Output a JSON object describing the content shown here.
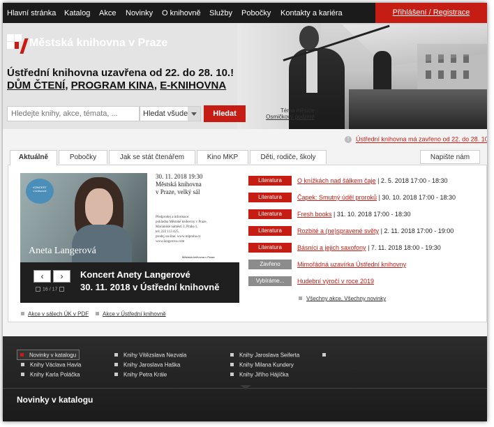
{
  "nav": {
    "items": [
      "Hlavní stránka",
      "Katalog",
      "Akce",
      "Novinky",
      "O knihovně",
      "Služby",
      "Pobočky",
      "Kontakty a kariéra"
    ],
    "login": "Přihlášení / Registrace"
  },
  "hero": {
    "logo_text": "Městská knihovna v Praze",
    "headline": "Ústřední knihovna uzavřena od 22. do 28. 10.!",
    "links": [
      "DŮM ČTENÍ",
      "PROGRAM KINA",
      "E-KNIHOVNA"
    ],
    "link_separator": ", ",
    "search_placeholder": "Hledejte knihy, akce, témata, ...",
    "search_scope": "Hledat všude",
    "search_button": "Hledat",
    "tema_label": "Téma měsíce",
    "tema_link": "Osmičkový podzim!"
  },
  "notice": {
    "icon": "!",
    "text": "Ústřední knihovna má zavřeno od 22. do 28. 10. 2018"
  },
  "tabs": [
    "Aktuálně",
    "Pobočky",
    "Jak se stát čtenářem",
    "Kino MKP",
    "Děti, rodiče, školy"
  ],
  "write_us": "Napište nám",
  "feature": {
    "poster_name": "Aneta Langerová",
    "poster_title": "30. 11. 2018 19:30\nMěstská knihovna\nv Praze, velký sál",
    "poster_small": "Předprodej a informace:\npokladna Městské knihovny v Praze,\nMariánské náměstí 1, Praha 1,\ntel: 222 113 425,\nprodej on-line: www.mlpraha.cz\nwww.langerova.com",
    "poster_badge": "KONCERT\nv knihovně",
    "poster_logo": "Městská knihovna v Praze",
    "caption_line1": "Koncert Anety Langerové",
    "caption_line2": "30. 11. 2018 v Ústřední knihovně",
    "prev": "‹",
    "next": "›",
    "counter": "16 / 17"
  },
  "feature_links": [
    "Akce v sálech ÚK v PDF",
    "Akce v Ústřední knihovně"
  ],
  "events": [
    {
      "tag": "Literatura",
      "title": "O knížkách nad šálkem čaje",
      "date": " | 2. 5. 2018 17:00 - 18:30",
      "gray": false
    },
    {
      "tag": "Literatura",
      "title": "Čapek: Smutný úděl proroků",
      "date": " | 30. 10. 2018 17:00 - 18:30",
      "gray": false
    },
    {
      "tag": "Literatura",
      "title": "Fresh books",
      "date": " | 31. 10. 2018 17:00 - 18:30",
      "gray": false
    },
    {
      "tag": "Literatura",
      "title": "Rozbité a (ne)spravené světy",
      "date": " | 2. 11. 2018 17:00 - 19:00",
      "gray": false
    },
    {
      "tag": "Literatura",
      "title": "Básníci a jejich saxofony",
      "date": " | 7. 11. 2018 18:00 - 19:30",
      "gray": false
    },
    {
      "tag": "Zavřeno",
      "title": "Mimořádná uzavírka Ústřední knihovny",
      "date": "",
      "gray": true
    },
    {
      "tag": "Vybíráme...",
      "title": "Hudební výročí v roce 2019",
      "date": "",
      "gray": true
    }
  ],
  "all_events": "Všechny akce, Všechny novinky",
  "footer": {
    "links": [
      [
        "Novinky v katalogu",
        "Knihy Vítězslava Nezvala",
        "Knihy Jaroslava Seiferta",
        ""
      ],
      [
        "Knihy Václava Havla",
        "Knihy Jaroslava Haška",
        "Knihy Milana Kundery"
      ],
      [
        "Knihy Karla Poláčka",
        "Knihy Petra Krále",
        "Knihy Jiřího Hájíčka"
      ]
    ],
    "title": "Novinky v katalogu"
  },
  "colors": {
    "brand_red": "#c51c14",
    "dark": "#1b1b1b",
    "tag_gray": "#8c8c8c"
  }
}
